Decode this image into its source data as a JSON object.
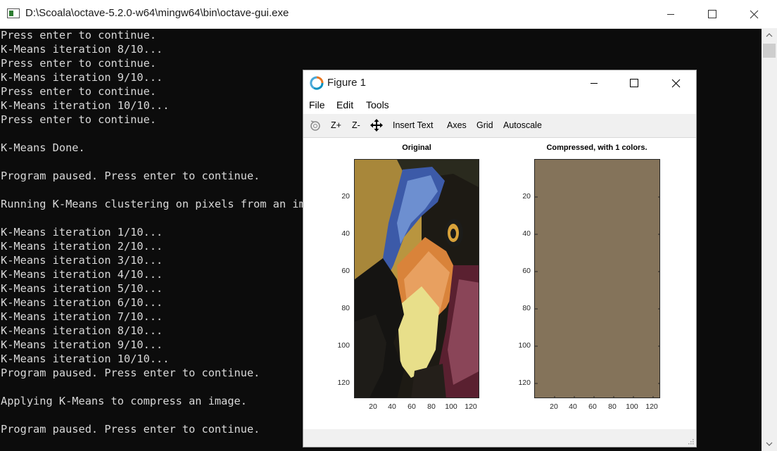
{
  "console_window": {
    "title": "D:\\Scoala\\octave-5.2.0-w64\\mingw64\\bin\\octave-gui.exe",
    "lines": [
      "Press enter to continue.",
      "K-Means iteration 8/10...",
      "Press enter to continue.",
      "K-Means iteration 9/10...",
      "Press enter to continue.",
      "K-Means iteration 10/10...",
      "Press enter to continue.",
      "",
      "K-Means Done.",
      "",
      "Program paused. Press enter to continue.",
      "",
      "Running K-Means clustering on pixels from an ima",
      "",
      "K-Means iteration 1/10...",
      "K-Means iteration 2/10...",
      "K-Means iteration 3/10...",
      "K-Means iteration 4/10...",
      "K-Means iteration 5/10...",
      "K-Means iteration 6/10...",
      "K-Means iteration 7/10...",
      "K-Means iteration 8/10...",
      "K-Means iteration 9/10...",
      "K-Means iteration 10/10...",
      "Program paused. Press enter to continue.",
      "",
      "Applying K-Means to compress an image.",
      "",
      "Program paused. Press enter to continue."
    ],
    "text_color": "#d9d9d9",
    "background": "#0c0c0c"
  },
  "figure_window": {
    "title": "Figure 1",
    "menu": [
      "File",
      "Edit",
      "Tools"
    ],
    "toolbar": {
      "rotate_icon": "rotate-icon",
      "zoom_in": "Z+",
      "zoom_out": "Z-",
      "pan_icon": "pan-move-icon",
      "insert_text": "Insert Text",
      "axes": "Axes",
      "grid": "Grid",
      "autoscale": "Autoscale"
    },
    "axes": [
      {
        "title": "Original",
        "content": "image of a bird",
        "yticks": [
          "20",
          "40",
          "60",
          "80",
          "100",
          "120"
        ],
        "xticks": [
          "20",
          "40",
          "60",
          "80",
          "100",
          "120"
        ]
      },
      {
        "title": "Compressed, with 1 colors.",
        "fill_color": "#84735a",
        "yticks": [
          "20",
          "40",
          "60",
          "80",
          "100",
          "120"
        ],
        "xticks": [
          "20",
          "40",
          "60",
          "80",
          "100",
          "120"
        ]
      }
    ]
  }
}
